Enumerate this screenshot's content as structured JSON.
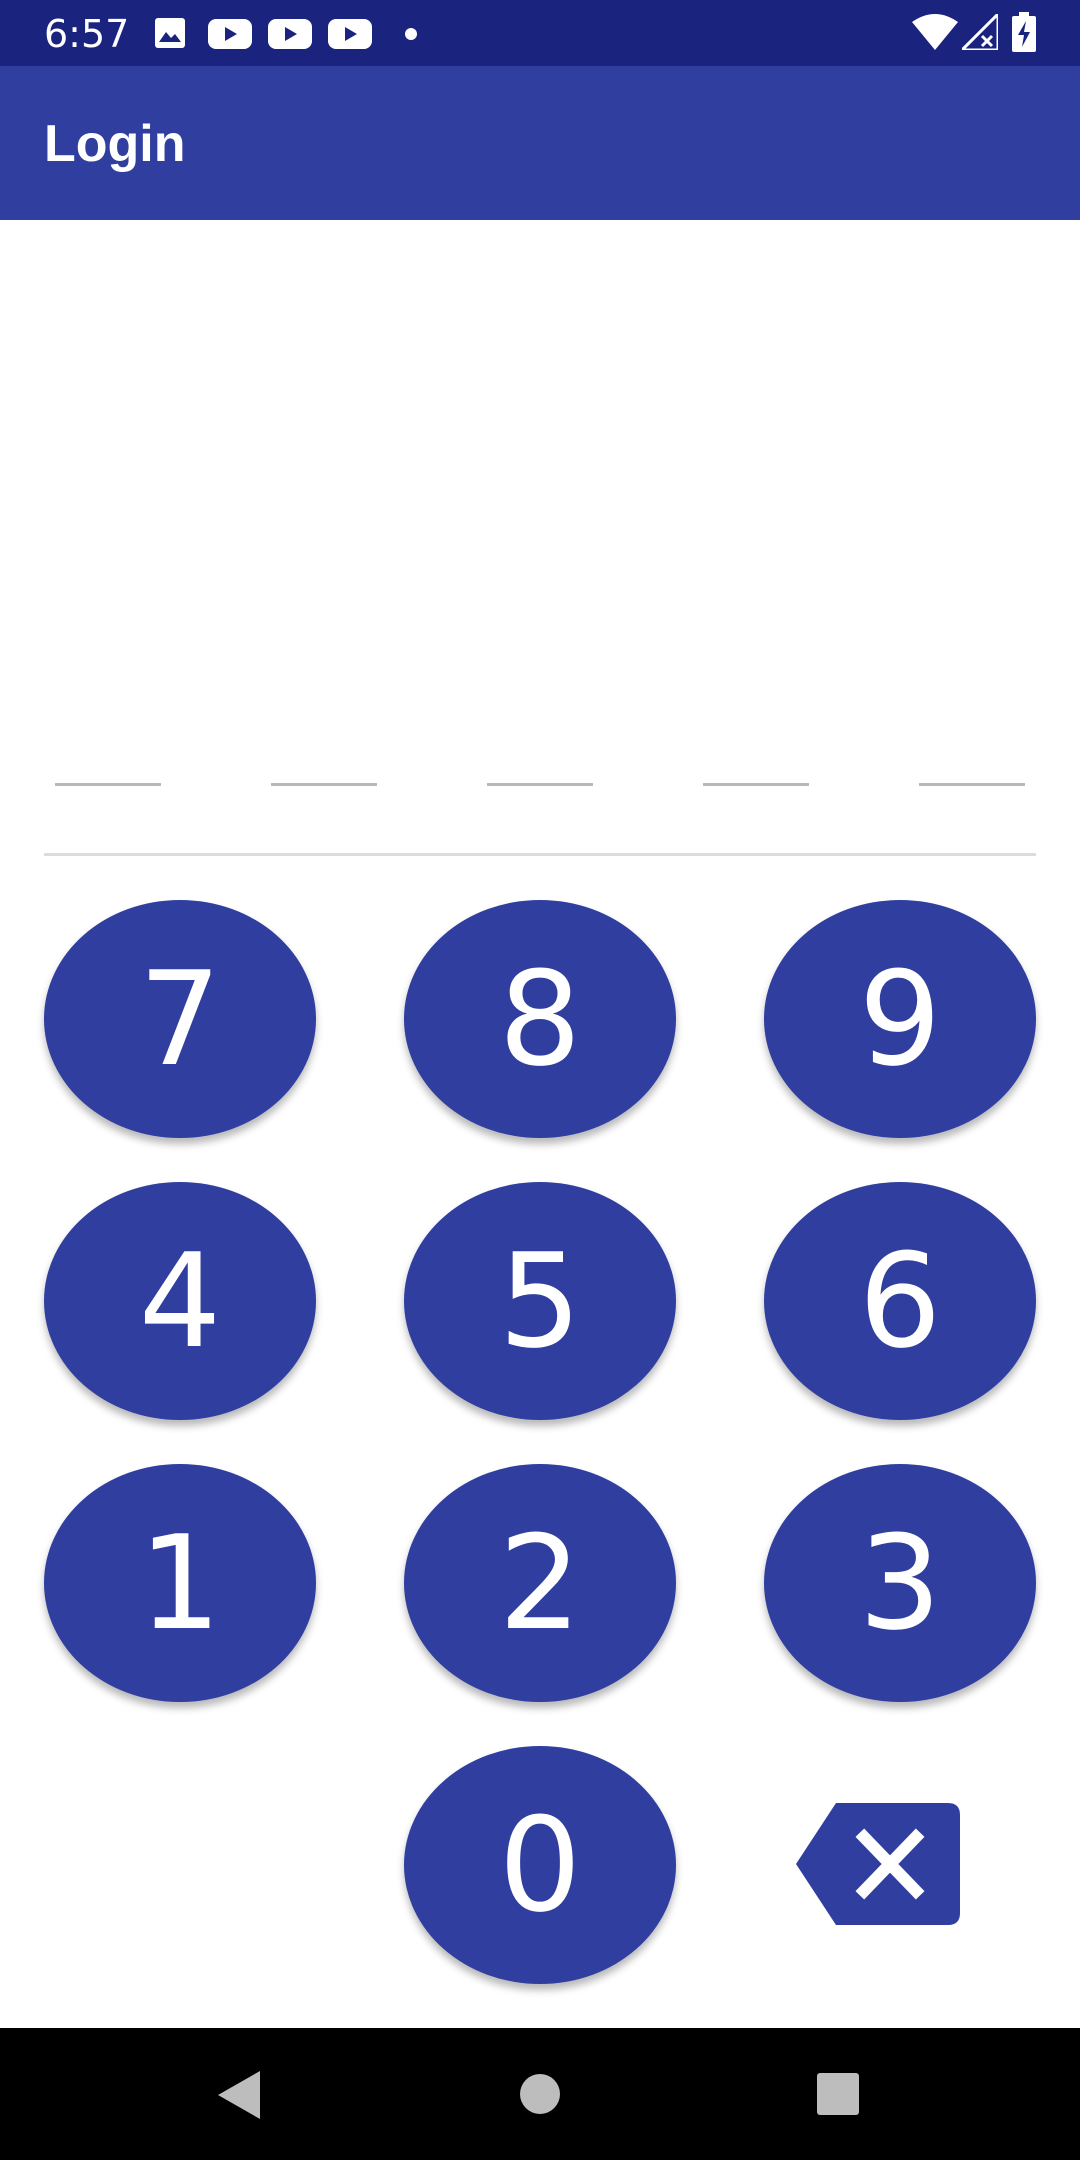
{
  "status_bar": {
    "time": "6:57",
    "icons": [
      "image-icon",
      "youtube-icon",
      "youtube-icon",
      "youtube-icon",
      "dot-icon",
      "wifi-icon",
      "signal-icon",
      "battery-charging-icon"
    ]
  },
  "app_bar": {
    "title": "Login"
  },
  "pin": {
    "length": 5,
    "entered": ""
  },
  "keypad": {
    "keys": [
      "7",
      "8",
      "9",
      "4",
      "5",
      "6",
      "1",
      "2",
      "3",
      "0"
    ],
    "backspace_icon": "backspace-icon"
  },
  "nav_bar": {
    "icons": [
      "back-icon",
      "home-icon",
      "recents-icon"
    ]
  },
  "colors": {
    "status_bar": "#1a237e",
    "primary": "#303f9f",
    "nav_bar": "#000000",
    "pin_line": "#b9b9b9"
  }
}
